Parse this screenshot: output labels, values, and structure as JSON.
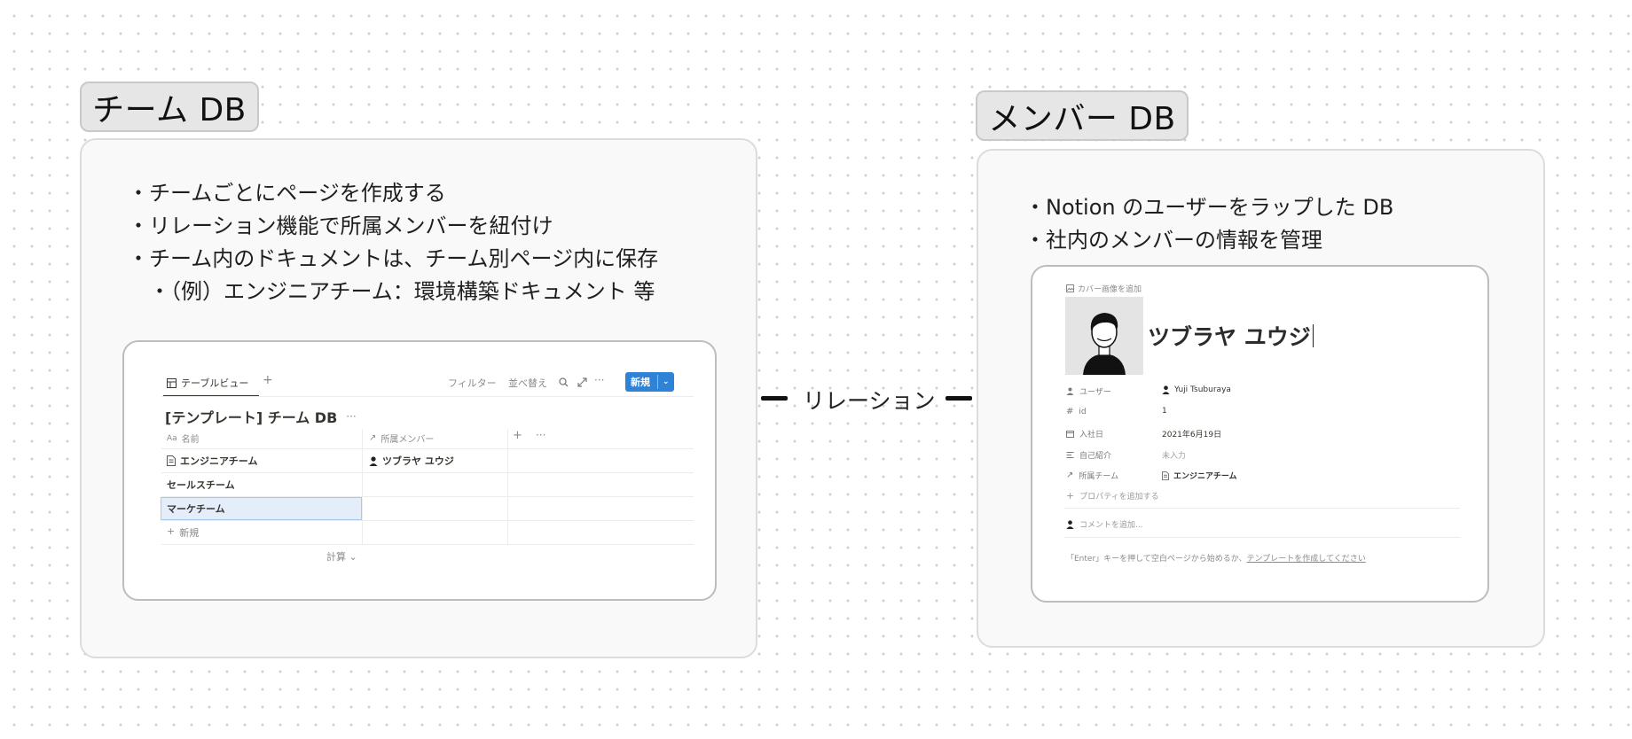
{
  "team_section": {
    "title": "チーム DB",
    "bullets": [
      "・チームごとにページを作成する",
      "・リレーション機能で所属メンバーを紐付け",
      "・チーム内のドキュメントは、チーム別ページ内に保存",
      "　・（例）エンジニアチーム：環境構築ドキュメント 等"
    ],
    "table_view": {
      "tab_label": "テーブルビュー",
      "add_view": "+",
      "filter": "フィルター",
      "sort": "並べ替え",
      "more": "···",
      "new_button": "新規",
      "db_title": "[テンプレート] チーム DB",
      "title_more": "···",
      "col_name": "名前",
      "col_members": "所属メンバー",
      "col_add": "+",
      "col_more": "···",
      "rows": [
        {
          "name": "エンジニアチーム",
          "member": "ツブラヤ ユウジ"
        },
        {
          "name": "セールスチーム",
          "member": ""
        },
        {
          "name": "マーケチーム",
          "member": ""
        }
      ],
      "add_row": "新規",
      "calc": "計算 ⌄",
      "selected_row_color": "#e3eefa"
    }
  },
  "relation": {
    "label": "リレーション"
  },
  "member_section": {
    "title": "メンバー DB",
    "bullets": [
      "・Notion のユーザーをラップした DB",
      "・社内のメンバーの情報を管理"
    ],
    "page": {
      "add_cover": "カバー画像を追加",
      "page_title": "ツブラヤ ユウジ",
      "properties": [
        {
          "icon": "person-icon",
          "label": "ユーザー",
          "value": "Yuji Tsuburaya"
        },
        {
          "icon": "hash-icon",
          "label": "id",
          "value": "1"
        },
        {
          "icon": "calendar-icon",
          "label": "入社日",
          "value": "2021年6月19日"
        },
        {
          "icon": "text-icon",
          "label": "自己紹介",
          "value": "未入力"
        },
        {
          "icon": "arrow-icon",
          "label": "所属チーム",
          "value": "エンジニアチーム"
        }
      ],
      "add_property": "プロパティを追加する",
      "comment_placeholder": "コメントを追加...",
      "footer_text": "「Enter」キーを押して空白ページから始めるか、",
      "footer_link": "テンプレートを作成してください"
    }
  }
}
